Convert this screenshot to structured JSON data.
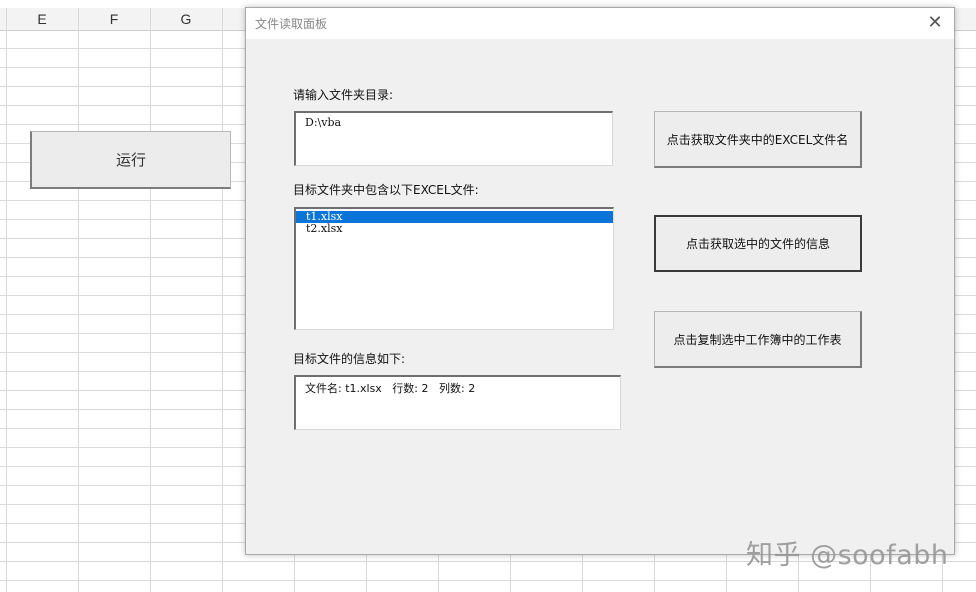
{
  "sheet": {
    "columns": [
      "E",
      "F",
      "G"
    ],
    "run_button_label": "运行"
  },
  "dialog": {
    "title": "文件读取面板",
    "close_glyph": "✕",
    "folder_label": "请输入文件夹目录:",
    "folder_value": "D:\\vba",
    "files_label": "目标文件夹中包含以下EXCEL文件:",
    "files": [
      "t1.xlsx",
      "t2.xlsx"
    ],
    "selected_file_index": 0,
    "info_label": "目标文件的信息如下:",
    "info_value": "文件名: t1.xlsx   行数: 2   列数: 2",
    "buttons": {
      "get_files": "点击获取文件夹中的EXCEL文件名",
      "get_info": "点击获取选中的文件的信息",
      "copy_sheets": "点击复制选中工作簿中的工作表"
    }
  },
  "watermark": "知乎 @soofabh",
  "colors": {
    "selection": "#0a74d9",
    "dialog_bg": "#f0f0f0"
  }
}
